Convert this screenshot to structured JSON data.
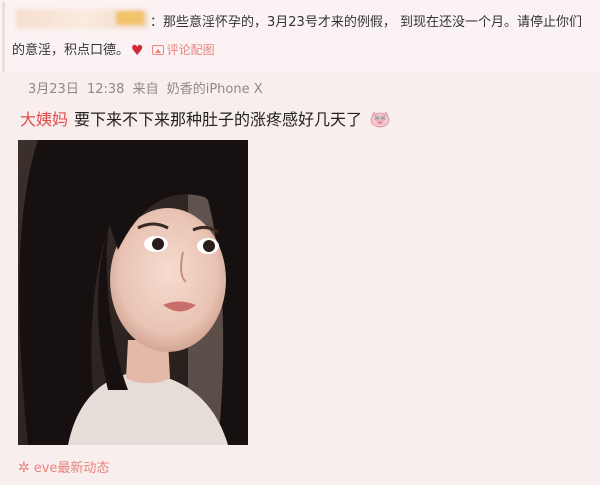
{
  "reply": {
    "text_line1": "：那些意淫怀孕的，3月23号才来的例假， 到现在还没一个月。请停止你们",
    "text_line2": "的意淫，积点口德。",
    "heart_icon": "heart-icon",
    "image_link_label": "评论配图"
  },
  "post": {
    "date": "3月23日",
    "time": "12:38",
    "source_prefix": "来自",
    "source": "奶香的iPhone X",
    "topic": "大姨妈",
    "body": "要下来不下来那种肚子的涨疼感好几天了",
    "emoji_icon": "pig-emoji-icon"
  },
  "footer": {
    "label": "eve最新动态",
    "icon": "sparkle-icon"
  },
  "colors": {
    "background": "#f9eeee",
    "accent": "#e9837c",
    "topic": "#e44b4b"
  }
}
